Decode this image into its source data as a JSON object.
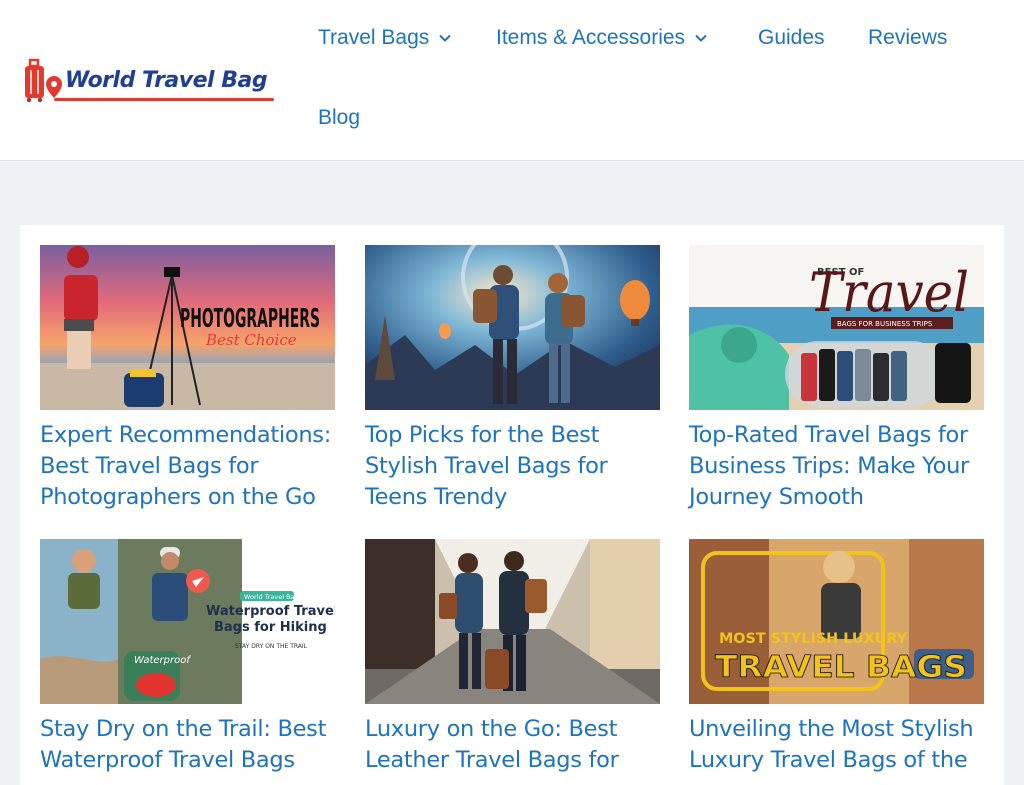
{
  "site": {
    "logo_text": "World Travel Bag"
  },
  "nav": {
    "items": [
      {
        "label": "Travel Bags",
        "has_dropdown": true
      },
      {
        "label": "Items & Accessories",
        "has_dropdown": true
      },
      {
        "label": "Guides",
        "has_dropdown": false
      },
      {
        "label": "Reviews",
        "has_dropdown": false
      },
      {
        "label": "Blog",
        "has_dropdown": false
      }
    ]
  },
  "posts": [
    {
      "title": "Expert Recommendations: Best Travel Bags for Photographers on the Go",
      "image_text": "PHOTOGRAPHERS",
      "image_subtext": "Best Choice"
    },
    {
      "title": "Top Picks for the Best Stylish Travel Bags for Teens Trendy"
    },
    {
      "title": "Top-Rated Travel Bags for Business Trips: Make Your Journey Smooth",
      "image_text": "Travel",
      "image_pretext": "BEST OF",
      "image_subtext": "BAGS FOR BUSINESS TRIPS"
    },
    {
      "title": "Stay Dry on the Trail: Best Waterproof Travel Bags",
      "image_badge": "World Travel Bags",
      "image_text": "Waterproof Travel Bags for Hiking",
      "image_subtext": "STAY DRY ON THE TRAIL",
      "image_label": "Waterproof"
    },
    {
      "title": "Luxury on the Go: Best Leather Travel Bags for"
    },
    {
      "title": "Unveiling the Most Stylish Luxury Travel Bags of the",
      "image_pretext": "MOST STYLISH LUXURY",
      "image_text": "TRAVEL BAGS"
    }
  ],
  "colors": {
    "link": "#1e73be",
    "background": "#eef2f5",
    "logo_blue": "#1f3f97",
    "logo_red": "#e23b2e"
  }
}
